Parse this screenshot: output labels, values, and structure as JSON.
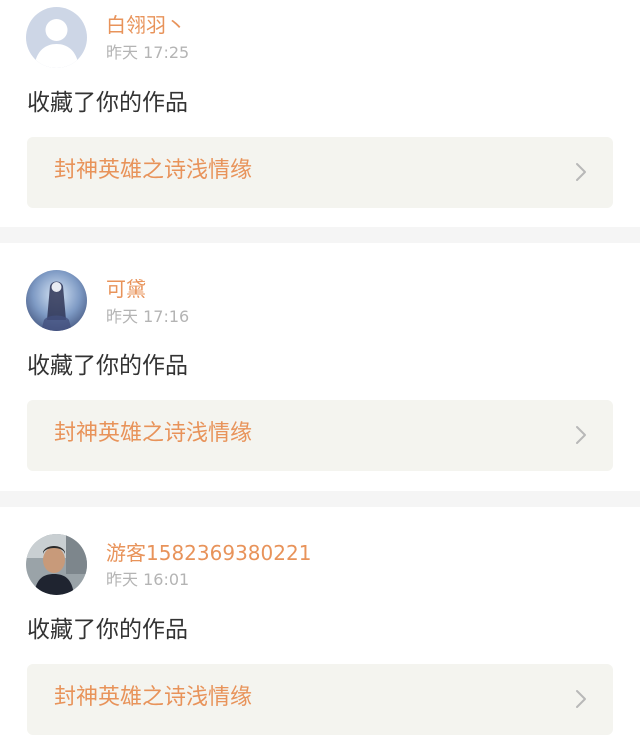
{
  "notifications": [
    {
      "user_name": "白翎羽丶",
      "time": "昨天 17:25",
      "action": "收藏了你的作品",
      "work_title": "封神英雄之诗浅情缘",
      "avatar": "default-avatar"
    },
    {
      "user_name": "可黛",
      "time": "昨天 17:16",
      "action": "收藏了你的作品",
      "work_title": "封神英雄之诗浅情缘",
      "avatar": "illustration-avatar"
    },
    {
      "user_name": "游客1582369380221",
      "time": "昨天 16:01",
      "action": "收藏了你的作品",
      "work_title": "封神英雄之诗浅情缘",
      "avatar": "photo-avatar"
    }
  ],
  "icons": {
    "arrow": "chevron-right-icon"
  },
  "colors": {
    "name": "#e8935a",
    "time": "#b4b4b4",
    "action_text": "#333333",
    "link_bg": "#f4f4ef",
    "divider": "#f5f5f5"
  }
}
